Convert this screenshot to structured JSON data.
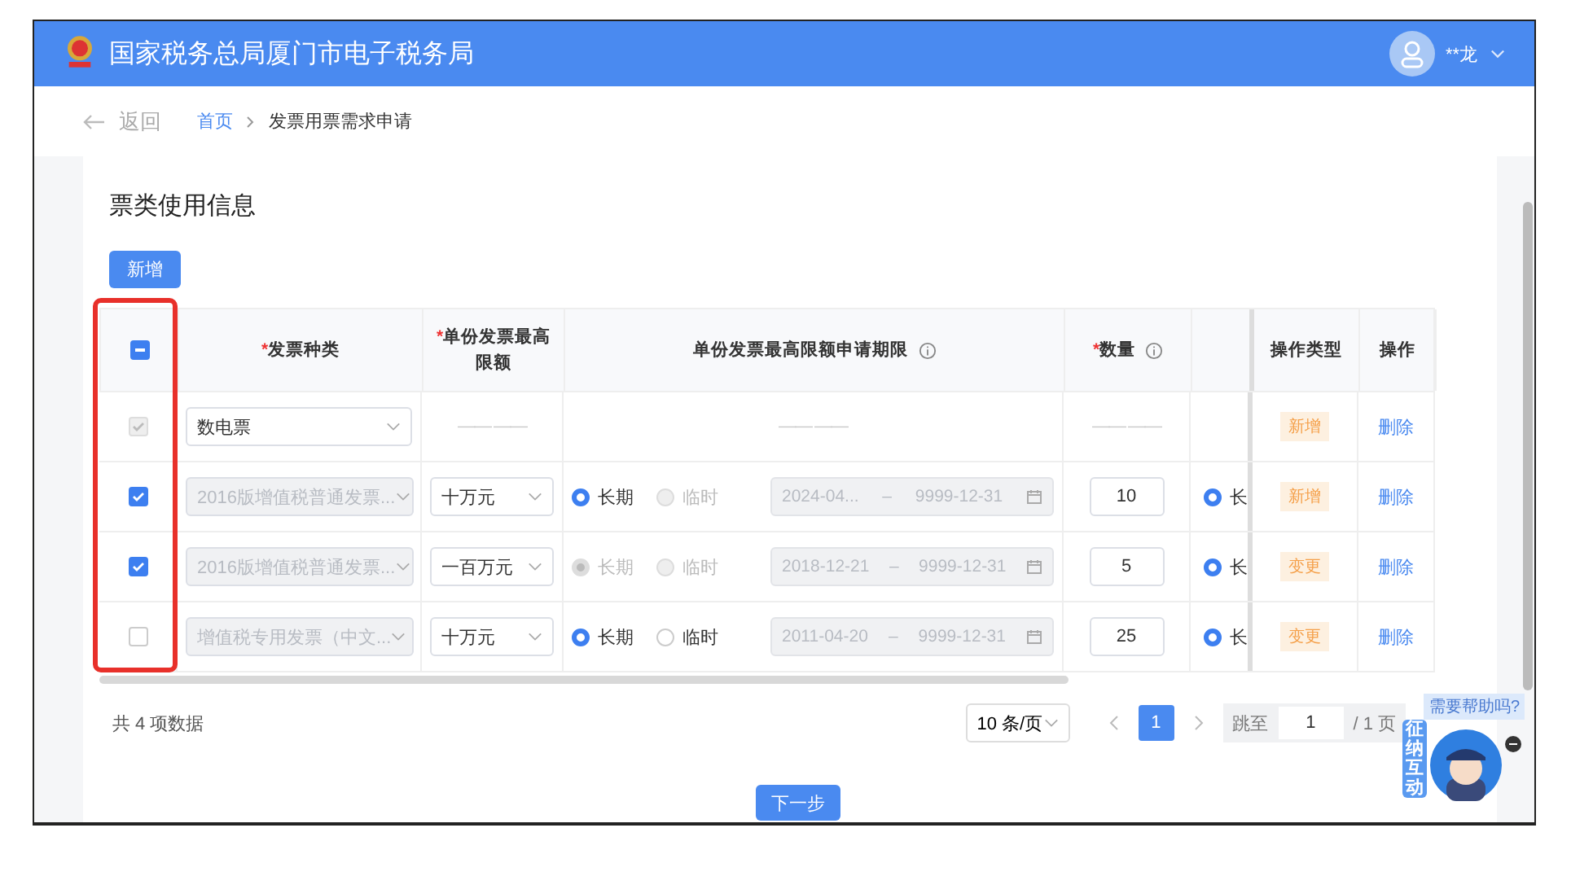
{
  "header": {
    "title": "国家税务总局厦门市电子税务局",
    "user": "**龙"
  },
  "breadcrumb": {
    "back": "返回",
    "items": [
      {
        "label": "首页",
        "link": true
      },
      {
        "label": "发票用票需求申请",
        "link": false
      }
    ]
  },
  "section": {
    "title": "票类使用信息",
    "add_button": "新增"
  },
  "table": {
    "select_all": {
      "indeterminate": true
    },
    "columns": [
      {
        "label": "发票种类",
        "required_mark": "*"
      },
      {
        "label": "单份发票最高限额",
        "required_mark": "*"
      },
      {
        "label": "单份发票最高限额申请期限",
        "info": true
      },
      {
        "label": "数量",
        "required_mark": "*",
        "info": true
      },
      {},
      {
        "label": "操作类型"
      },
      {
        "label": "操作"
      }
    ],
    "rows": [
      {
        "kind": "summary",
        "checked": true,
        "check_disabled": true,
        "invoice_type": "数电票",
        "type_disabled": false,
        "limit": "—— ——",
        "term": "—— ——",
        "quantity": "—— ——",
        "op_type": "新增",
        "action": "删除"
      },
      {
        "kind": "editable",
        "checked": true,
        "check_disabled": false,
        "invoice_type": "2016版增值税普通发票...",
        "type_disabled": true,
        "limit": "十万元",
        "term_options": [
          {
            "label": "长期",
            "selected": true,
            "disabled": false
          },
          {
            "label": "临时",
            "selected": false,
            "disabled": true
          }
        ],
        "start": "2024-04...",
        "sep": "–",
        "end": "9999-12-31",
        "quantity": "10",
        "extra": {
          "label": "长",
          "selected": true
        },
        "op_type": "新增",
        "action": "删除"
      },
      {
        "kind": "editable",
        "checked": true,
        "check_disabled": false,
        "invoice_type": "2016版增值税普通发票...",
        "type_disabled": true,
        "limit": "一百万元",
        "term_options": [
          {
            "label": "长期",
            "selected": true,
            "disabled": true
          },
          {
            "label": "临时",
            "selected": false,
            "disabled": true
          }
        ],
        "start": "2018-12-21",
        "sep": "–",
        "end": "9999-12-31",
        "quantity": "5",
        "extra": {
          "label": "长",
          "selected": true
        },
        "op_type": "变更",
        "action": "删除"
      },
      {
        "kind": "editable",
        "checked": false,
        "check_disabled": false,
        "invoice_type": "增值税专用发票（中文...",
        "type_disabled": true,
        "limit": "十万元",
        "term_options": [
          {
            "label": "长期",
            "selected": true,
            "disabled": false
          },
          {
            "label": "临时",
            "selected": false,
            "disabled": false
          }
        ],
        "start": "2011-04-20",
        "sep": "–",
        "end": "9999-12-31",
        "quantity": "25",
        "extra": {
          "label": "长",
          "selected": true
        },
        "op_type": "变更",
        "action": "删除"
      }
    ]
  },
  "pagination": {
    "total": "共 4 项数据",
    "page_size": "10 条/页",
    "pages": [
      {
        "label": "1",
        "selected": true
      }
    ],
    "jump_label": "跳至",
    "jump_value": "1",
    "page_count": "/ 1 页"
  },
  "next_button": "下一步",
  "assistant": {
    "bubble": "需要帮助吗?",
    "label": "征纳互动"
  }
}
